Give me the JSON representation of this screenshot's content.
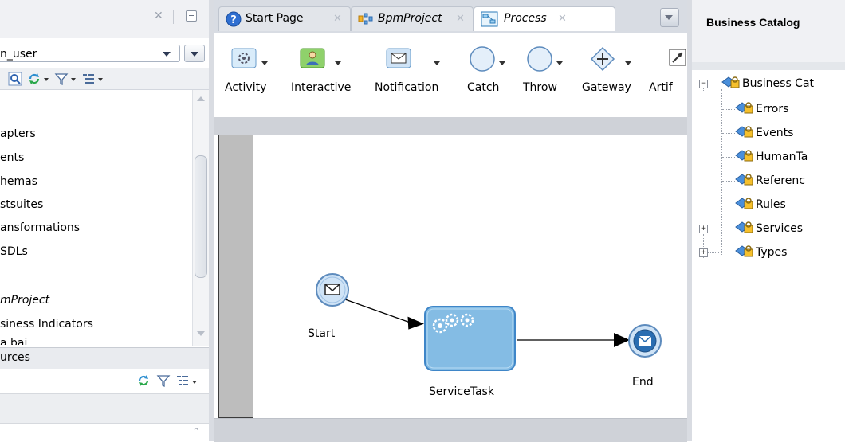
{
  "left_panel": {
    "user_select_value": "n_user",
    "tree_items": [
      "apters",
      "ents",
      "hemas",
      "stsuites",
      "ansformations",
      "SDLs",
      "mProject",
      "siness Indicators",
      "a bai"
    ],
    "resources_header": "urces"
  },
  "editor": {
    "tabs": [
      {
        "label": "Start Page",
        "icon": "help-circle-icon"
      },
      {
        "label": "BpmProject",
        "icon": "project-icon"
      },
      {
        "label": "Process",
        "icon": "process-icon"
      }
    ],
    "palette": [
      {
        "label": "Activity",
        "icon": "activity-gear-icon"
      },
      {
        "label": "Interactive",
        "icon": "interactive-user-icon"
      },
      {
        "label": "Notification",
        "icon": "envelope-icon"
      },
      {
        "label": "Catch",
        "icon": "catch-circle-icon"
      },
      {
        "label": "Throw",
        "icon": "throw-circle-icon"
      },
      {
        "label": "Gateway",
        "icon": "gateway-diamond-icon"
      },
      {
        "label": "Artif",
        "icon": "artifact-icon"
      }
    ],
    "diagram": {
      "start_label": "Start",
      "task_label": "ServiceTask",
      "end_label": "End"
    }
  },
  "right_panel": {
    "title": "Business Catalog",
    "tree_root": "Business Cat",
    "tree_children": [
      "Errors",
      "Events",
      "HumanTa",
      "Referenc",
      "Rules",
      "Services",
      "Types"
    ]
  },
  "colors": {
    "accent": "#3f86c8",
    "task_fill": "#84bce4",
    "event_fill": "#cfe3f6",
    "end_fill": "#2a6db1"
  }
}
